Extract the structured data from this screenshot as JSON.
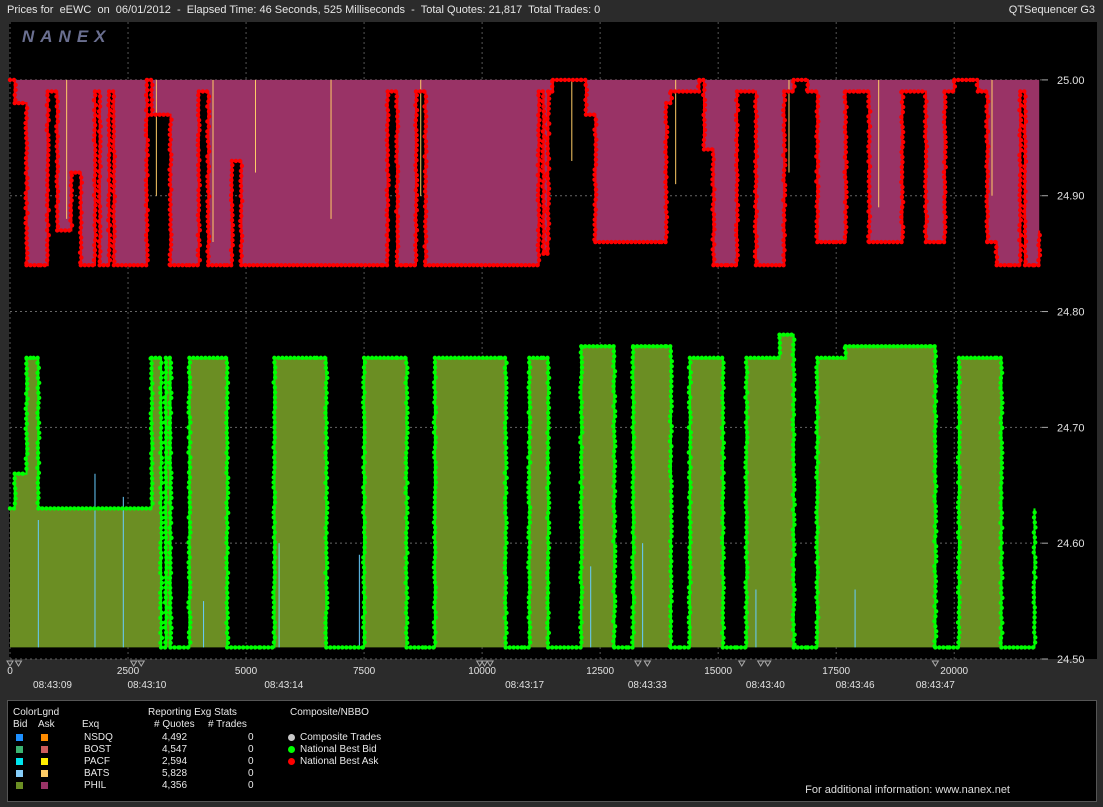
{
  "header": {
    "title": "Prices for  eEWC  on  06/01/2012  -  Elapsed Time: 46 Seconds, 525 Milliseconds  -  Total Quotes: 21,817  Total Trades: 0",
    "app_name": "QTSequencer G3"
  },
  "watermark": "NANEX",
  "chart_data": {
    "type": "area",
    "title": "",
    "y_ticks": [
      "25.00",
      "24.90",
      "24.80",
      "24.70",
      "24.60",
      "24.50"
    ],
    "ylim": [
      24.5,
      25.05
    ],
    "x_ticks": [
      "0",
      "2500",
      "5000",
      "7500",
      "10000",
      "12500",
      "15000",
      "17500",
      "20000"
    ],
    "xlim": [
      0,
      21817
    ],
    "time_labels": [
      {
        "x": 900,
        "label": "08:43:09"
      },
      {
        "x": 2900,
        "label": "08:43:10"
      },
      {
        "x": 5800,
        "label": "08:43:14"
      },
      {
        "x": 10900,
        "label": "08:43:17"
      },
      {
        "x": 13500,
        "label": "08:43:33"
      },
      {
        "x": 16000,
        "label": "08:43:40"
      },
      {
        "x": 17900,
        "label": "08:43:46"
      },
      {
        "x": 19600,
        "label": "08:43:47"
      }
    ],
    "series": [
      {
        "name": "National Best Ask",
        "color": "#ff0000",
        "points": [
          [
            0,
            25.0
          ],
          [
            100,
            24.98
          ],
          [
            350,
            24.84
          ],
          [
            650,
            24.84
          ],
          [
            800,
            24.99
          ],
          [
            1000,
            24.87
          ],
          [
            1300,
            24.92
          ],
          [
            1500,
            24.84
          ],
          [
            1800,
            24.99
          ],
          [
            1900,
            24.84
          ],
          [
            2100,
            24.99
          ],
          [
            2200,
            24.84
          ],
          [
            2800,
            24.84
          ],
          [
            2900,
            25.0
          ],
          [
            3000,
            24.97
          ],
          [
            3400,
            24.84
          ],
          [
            3800,
            24.84
          ],
          [
            4000,
            24.99
          ],
          [
            4200,
            24.84
          ],
          [
            4600,
            24.84
          ],
          [
            4700,
            24.93
          ],
          [
            4900,
            24.84
          ],
          [
            7900,
            24.84
          ],
          [
            8000,
            24.99
          ],
          [
            8200,
            24.84
          ],
          [
            8400,
            24.84
          ],
          [
            8600,
            24.99
          ],
          [
            8800,
            24.84
          ],
          [
            11000,
            24.84
          ],
          [
            11200,
            24.99
          ],
          [
            11300,
            24.85
          ],
          [
            11400,
            24.99
          ],
          [
            11500,
            25.0
          ],
          [
            12100,
            25.0
          ],
          [
            12200,
            24.97
          ],
          [
            12400,
            24.86
          ],
          [
            13800,
            24.86
          ],
          [
            13900,
            24.98
          ],
          [
            14000,
            24.99
          ],
          [
            14600,
            25.0
          ],
          [
            14700,
            24.94
          ],
          [
            14900,
            24.84
          ],
          [
            15200,
            24.84
          ],
          [
            15400,
            24.99
          ],
          [
            15800,
            24.84
          ],
          [
            16300,
            24.84
          ],
          [
            16400,
            24.99
          ],
          [
            16600,
            25.0
          ],
          [
            16900,
            24.99
          ],
          [
            17100,
            24.86
          ],
          [
            17500,
            24.86
          ],
          [
            17700,
            24.99
          ],
          [
            18000,
            24.99
          ],
          [
            18200,
            24.86
          ],
          [
            18800,
            24.86
          ],
          [
            18900,
            24.99
          ],
          [
            19400,
            24.86
          ],
          [
            19700,
            24.86
          ],
          [
            19800,
            24.99
          ],
          [
            20000,
            25.0
          ],
          [
            20400,
            25.0
          ],
          [
            20500,
            24.99
          ],
          [
            20700,
            24.86
          ],
          [
            20900,
            24.84
          ],
          [
            21200,
            24.84
          ],
          [
            21400,
            24.99
          ],
          [
            21500,
            24.84
          ],
          [
            21700,
            24.84
          ],
          [
            21800,
            24.87
          ]
        ],
        "gaps": [
          [
            11400,
            11450
          ],
          [
            20100,
            20200
          ]
        ]
      },
      {
        "name": "National Best Bid",
        "color": "#00ff00",
        "points": [
          [
            0,
            24.63
          ],
          [
            100,
            24.66
          ],
          [
            350,
            24.76
          ],
          [
            500,
            24.76
          ],
          [
            600,
            24.63
          ],
          [
            2800,
            24.63
          ],
          [
            3000,
            24.76
          ],
          [
            3200,
            24.51
          ],
          [
            3300,
            24.76
          ],
          [
            3400,
            24.51
          ],
          [
            3600,
            24.51
          ],
          [
            3800,
            24.76
          ],
          [
            4400,
            24.76
          ],
          [
            4600,
            24.51
          ],
          [
            5300,
            24.51
          ],
          [
            5600,
            24.76
          ],
          [
            6500,
            24.76
          ],
          [
            6700,
            24.51
          ],
          [
            7300,
            24.51
          ],
          [
            7500,
            24.76
          ],
          [
            8200,
            24.76
          ],
          [
            8400,
            24.51
          ],
          [
            8800,
            24.51
          ],
          [
            9000,
            24.76
          ],
          [
            10400,
            24.76
          ],
          [
            10500,
            24.51
          ],
          [
            10900,
            24.51
          ],
          [
            11000,
            24.76
          ],
          [
            11300,
            24.76
          ],
          [
            11400,
            24.51
          ],
          [
            12000,
            24.51
          ],
          [
            12100,
            24.77
          ],
          [
            12700,
            24.77
          ],
          [
            12800,
            24.51
          ],
          [
            13100,
            24.51
          ],
          [
            13200,
            24.77
          ],
          [
            13900,
            24.77
          ],
          [
            14000,
            24.51
          ],
          [
            14200,
            24.51
          ],
          [
            14400,
            24.76
          ],
          [
            15000,
            24.76
          ],
          [
            15100,
            24.51
          ],
          [
            15400,
            24.51
          ],
          [
            15600,
            24.76
          ],
          [
            16100,
            24.76
          ],
          [
            16300,
            24.78
          ],
          [
            16600,
            24.51
          ],
          [
            16900,
            24.51
          ],
          [
            17100,
            24.76
          ],
          [
            17700,
            24.77
          ],
          [
            19500,
            24.77
          ],
          [
            19600,
            24.51
          ],
          [
            19900,
            24.51
          ],
          [
            20100,
            24.76
          ],
          [
            20900,
            24.76
          ],
          [
            21000,
            24.51
          ],
          [
            21500,
            24.51
          ],
          [
            21700,
            24.63
          ]
        ]
      }
    ],
    "colors": {
      "ask_fill": "#993366",
      "bid_fill": "#6b8e23",
      "trade_light": "#ffcc66",
      "trade_blue": "#66ccff"
    }
  },
  "legend": {
    "color_legend_title": "ColorLgnd",
    "bid_header": "Bid",
    "ask_header": "Ask",
    "exq_header": "Exq",
    "stats_title": "Reporting Exg Stats",
    "quotes_header": "# Quotes",
    "trades_header": "# Trades",
    "composite_title": "Composite/NBBO",
    "exchanges": [
      {
        "name": "NSDQ",
        "quotes": "4,492",
        "trades": "0",
        "bid_color": "#1e90ff",
        "ask_color": "#ff8c00"
      },
      {
        "name": "BOST",
        "quotes": "4,547",
        "trades": "0",
        "bid_color": "#3cb371",
        "ask_color": "#cd5c5c"
      },
      {
        "name": "PACF",
        "quotes": "2,594",
        "trades": "0",
        "bid_color": "#00e5ee",
        "ask_color": "#ffee00"
      },
      {
        "name": "BATS",
        "quotes": "5,828",
        "trades": "0",
        "bid_color": "#87cefa",
        "ask_color": "#ffcc66"
      },
      {
        "name": "PHIL",
        "quotes": "4,356",
        "trades": "0",
        "bid_color": "#6b8e23",
        "ask_color": "#993366"
      }
    ],
    "composite": [
      {
        "label": "Composite Trades",
        "color": "#c8c8c8"
      },
      {
        "label": "National Best Bid",
        "color": "#00ff00"
      },
      {
        "label": "National Best Ask",
        "color": "#ff0000"
      }
    ],
    "info": "For additional information: www.nanex.net"
  }
}
